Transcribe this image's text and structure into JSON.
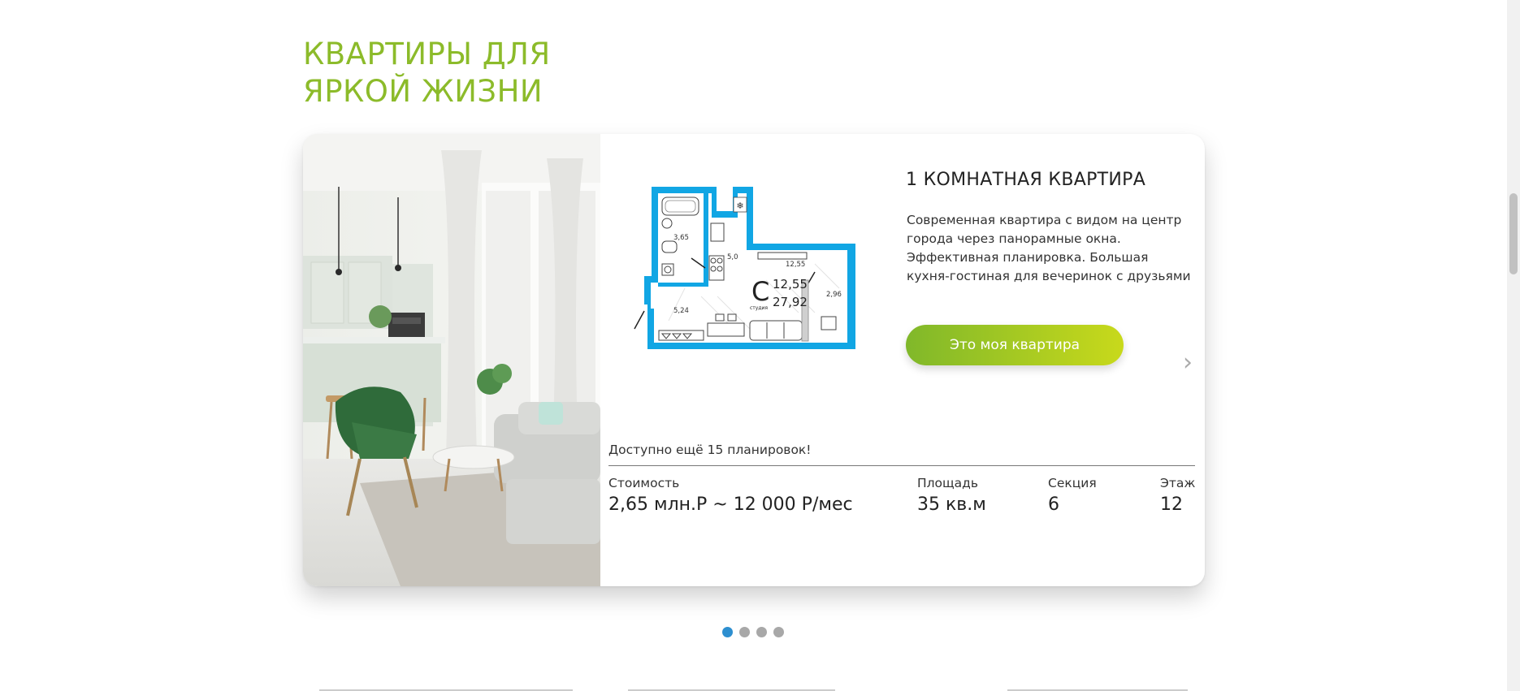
{
  "section": {
    "title_line1": "КВАРТИРЫ ДЛЯ",
    "title_line2": "ЯРКОЙ ЖИЗНИ"
  },
  "card": {
    "title": "1 КОМНАТНАЯ КВАРТИРА",
    "description": "Современная квартира с видом на центр города через панорамные окна. Эффективная планировка. Большая кухня-гостиная для вечеринок с друзьями",
    "cta_label": "Это моя квартира",
    "next_arrow": "›",
    "available_text": "Доступно ещё 15 планировок!",
    "stats": {
      "price_label": "Стоимость",
      "price_value": "2,65 млн.Р ~ 12 000 Р/мес",
      "area_label": "Площадь",
      "area_value": "35 кв.м",
      "section_label": "Секция",
      "section_value": "6",
      "floor_label": "Этаж",
      "floor_value": "12"
    },
    "floorplan": {
      "type_letter": "С",
      "type_caption": "студия",
      "living_area": "12,55",
      "total_area": "27,92",
      "rooms": {
        "bathroom": "3,65",
        "kitchen": "5,0",
        "hall": "5,24",
        "room": "12,55",
        "balcony": "2,96"
      }
    }
  },
  "slider": {
    "slide_count": 4,
    "active_index": 0
  },
  "colors": {
    "title_green": "#8cbb2a",
    "cta_gradient_start": "#80b82a",
    "cta_gradient_end": "#c8d91b",
    "plan_blue": "#11a6e4",
    "dot_active": "#2d8fd0",
    "dot_inactive": "#a8a8a8"
  }
}
